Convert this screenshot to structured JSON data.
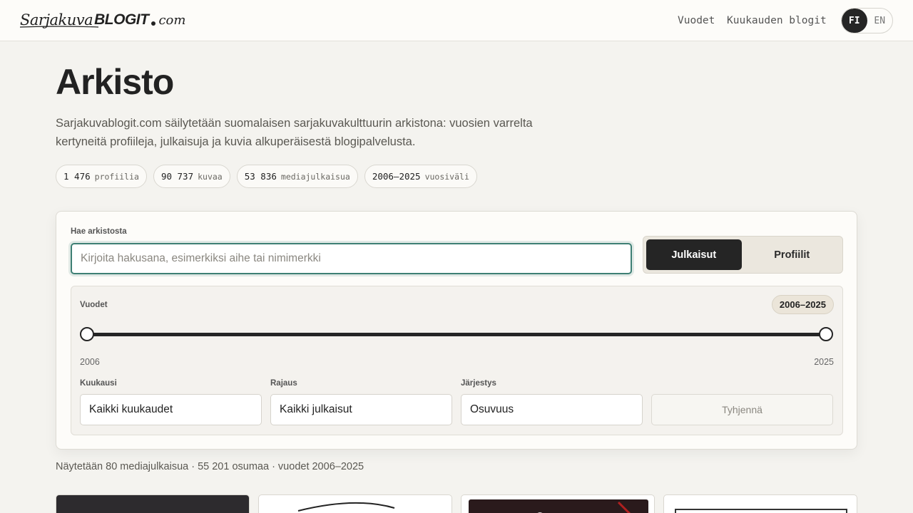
{
  "header": {
    "logo_script": "Sarjakuva",
    "logo_bold": "BLOGIT",
    "logo_com": "com",
    "nav": [
      "Vuodet",
      "Kuukauden blogit"
    ],
    "lang_active": "FI",
    "lang_inactive": "EN"
  },
  "hero": {
    "title": "Arkisto",
    "intro": "Sarjakuvablogit.com säilytetään suomalaisen sarjakuvakulttuurin arkistona: vuosien varrelta kertyneitä profiileja, julkaisuja ja kuvia alkuperäisestä blogipalvelusta.",
    "stats": [
      {
        "num": "1 476",
        "label": "profiilia"
      },
      {
        "num": "90 737",
        "label": "kuvaa"
      },
      {
        "num": "53 836",
        "label": "mediajulkaisua"
      },
      {
        "num": "2006–2025",
        "label": "vuosiväli"
      }
    ]
  },
  "search": {
    "label": "Hae arkistosta",
    "placeholder": "Kirjoita hakusana, esimerkiksi aihe tai nimimerkki",
    "value": "",
    "mode_active": "Julkaisut",
    "mode_inactive": "Profiilit"
  },
  "filters": {
    "years_label": "Vuodet",
    "range_badge": "2006–2025",
    "range_min": "2006",
    "range_max": "2025",
    "range_start_fraction": 0,
    "range_end_fraction": 1,
    "month_label": "Kuukausi",
    "month_value": "Kaikki kuukaudet",
    "scope_label": "Rajaus",
    "scope_value": "Kaikki julkaisut",
    "sort_label": "Järjestys",
    "sort_value": "Osuvuus",
    "clear_label": "Tyhjennä"
  },
  "results": {
    "summary": "Näytetään 80 mediajulkaisua · 55 201 osumaa · vuodet 2006–2025"
  },
  "colors": {
    "accent": "#3e7f74",
    "dark": "#252525",
    "background": "#f4f3ef"
  }
}
